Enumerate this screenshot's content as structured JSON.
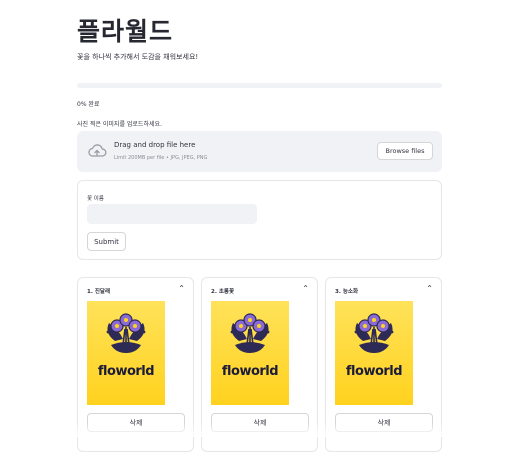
{
  "header": {
    "title": "플라월드",
    "subtitle": "꽃을 하나씩 추가해서 도감을 채워보세요!"
  },
  "progress": {
    "value": 0,
    "label": "0% 완료"
  },
  "uploader": {
    "label": "사진 찍은 이미지를 업로드하세요.",
    "drop_title": "Drag and drop file here",
    "drop_hint": "Limit 200MB per file • JPG, JPEG, PNG",
    "browse_label": "Browse files",
    "icon": "cloud-upload-icon"
  },
  "form": {
    "field_label": "꽃 이름",
    "field_value": "",
    "field_placeholder": "",
    "submit_label": "Submit"
  },
  "cards": [
    {
      "title": "1. 진달래",
      "image_text": "floworld",
      "delete_label": "삭제"
    },
    {
      "title": "2. 초롱꽃",
      "image_text": "floworld",
      "delete_label": "삭제"
    },
    {
      "title": "3. 능소화",
      "image_text": "floworld",
      "delete_label": "삭제"
    }
  ],
  "colors": {
    "accent": "#ff4b4b",
    "card_image_bg": "#ffd21e",
    "flower_petal": "#8a6bd6",
    "text": "#31333f"
  }
}
